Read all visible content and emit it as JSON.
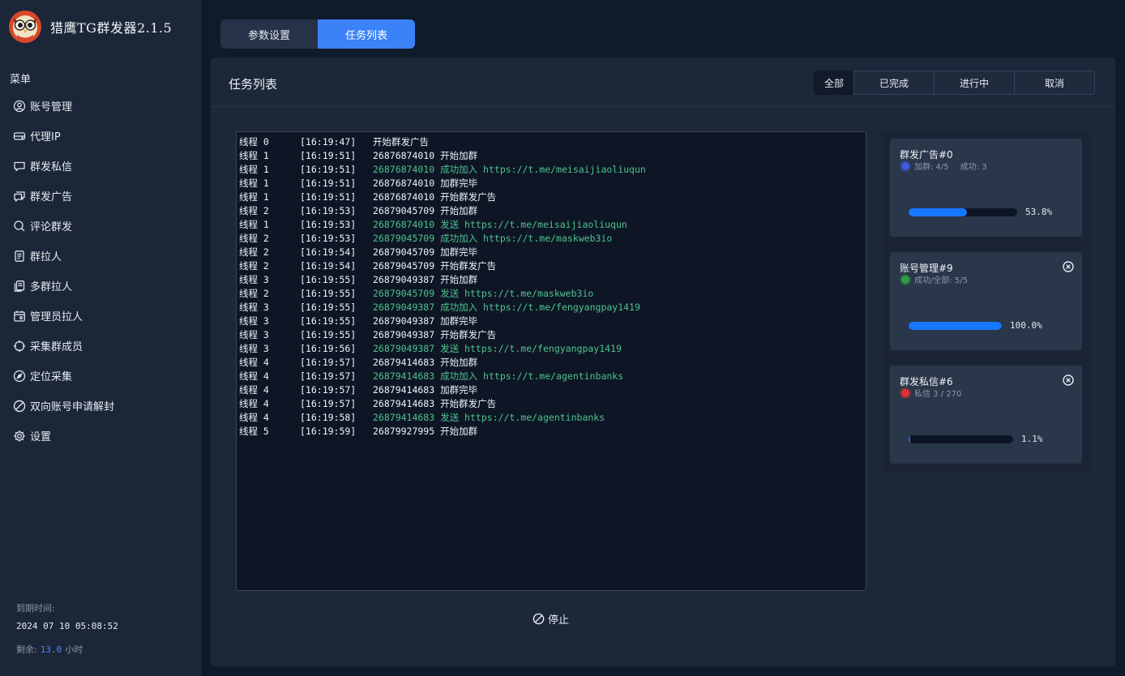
{
  "app": {
    "title": "猎鹰TG群发器2.1.5"
  },
  "sidebar": {
    "menu_label": "菜单",
    "items": [
      {
        "label": "账号管理",
        "icon": "user-circle-icon"
      },
      {
        "label": "代理IP",
        "icon": "server-icon"
      },
      {
        "label": "群发私信",
        "icon": "chat-bubble-icon"
      },
      {
        "label": "群发广告",
        "icon": "chat-bubbles-icon"
      },
      {
        "label": "评论群发",
        "icon": "comment-search-icon"
      },
      {
        "label": "群拉人",
        "icon": "document-icon"
      },
      {
        "label": "多群拉人",
        "icon": "documents-icon"
      },
      {
        "label": "管理员拉人",
        "icon": "calendar-user-icon"
      },
      {
        "label": "采集群成员",
        "icon": "crosshair-icon"
      },
      {
        "label": "定位采集",
        "icon": "compass-icon"
      },
      {
        "label": "双向账号申请解封",
        "icon": "ban-icon"
      },
      {
        "label": "设置",
        "icon": "gear-icon"
      }
    ],
    "expiry_label": "到期时间:",
    "expiry_value": "2024 07 10 05:08:52",
    "remaining_label": "剩余:",
    "remaining_value": "13.0",
    "remaining_unit": "小时"
  },
  "top_tabs": [
    "参数设置",
    "任务列表"
  ],
  "panel": {
    "title": "任务列表",
    "filters": [
      "全部",
      "已完成",
      "进行中",
      "取消"
    ]
  },
  "log": [
    {
      "thread": "线程 0",
      "time": "[16:19:47]",
      "account": "",
      "action": "开始群发广告",
      "url": "",
      "success": false
    },
    {
      "thread": "线程 1",
      "time": "[16:19:51]",
      "account": "26876874010",
      "action": "开始加群",
      "url": "",
      "success": false
    },
    {
      "thread": "线程 1",
      "time": "[16:19:51]",
      "account": "26876874010",
      "action": "成功加入",
      "url": "https://t.me/meisaijiaoliuqun",
      "success": true
    },
    {
      "thread": "线程 1",
      "time": "[16:19:51]",
      "account": "26876874010",
      "action": "加群完毕",
      "url": "",
      "success": false
    },
    {
      "thread": "线程 1",
      "time": "[16:19:51]",
      "account": "26876874010",
      "action": "开始群发广告",
      "url": "",
      "success": false
    },
    {
      "thread": "线程 2",
      "time": "[16:19:53]",
      "account": "26879045709",
      "action": "开始加群",
      "url": "",
      "success": false
    },
    {
      "thread": "线程 1",
      "time": "[16:19:53]",
      "account": "26876874010",
      "action": "发送",
      "url": "https://t.me/meisaijiaoliuqun",
      "success": true
    },
    {
      "thread": "线程 2",
      "time": "[16:19:53]",
      "account": "26879045709",
      "action": "成功加入",
      "url": "https://t.me/maskweb3io",
      "success": true
    },
    {
      "thread": "线程 2",
      "time": "[16:19:54]",
      "account": "26879045709",
      "action": "加群完毕",
      "url": "",
      "success": false
    },
    {
      "thread": "线程 2",
      "time": "[16:19:54]",
      "account": "26879045709",
      "action": "开始群发广告",
      "url": "",
      "success": false
    },
    {
      "thread": "线程 3",
      "time": "[16:19:55]",
      "account": "26879049387",
      "action": "开始加群",
      "url": "",
      "success": false
    },
    {
      "thread": "线程 2",
      "time": "[16:19:55]",
      "account": "26879045709",
      "action": "发送",
      "url": "https://t.me/maskweb3io",
      "success": true
    },
    {
      "thread": "线程 3",
      "time": "[16:19:55]",
      "account": "26879049387",
      "action": "成功加入",
      "url": "https://t.me/fengyangpay1419",
      "success": true
    },
    {
      "thread": "线程 3",
      "time": "[16:19:55]",
      "account": "26879049387",
      "action": "加群完毕",
      "url": "",
      "success": false
    },
    {
      "thread": "线程 3",
      "time": "[16:19:55]",
      "account": "26879049387",
      "action": "开始群发广告",
      "url": "",
      "success": false
    },
    {
      "thread": "线程 3",
      "time": "[16:19:56]",
      "account": "26879049387",
      "action": "发送",
      "url": "https://t.me/fengyangpay1419",
      "success": true
    },
    {
      "thread": "线程 4",
      "time": "[16:19:57]",
      "account": "26879414683",
      "action": "开始加群",
      "url": "",
      "success": false
    },
    {
      "thread": "线程 4",
      "time": "[16:19:57]",
      "account": "26879414683",
      "action": "成功加入",
      "url": "https://t.me/agentinbanks",
      "success": true
    },
    {
      "thread": "线程 4",
      "time": "[16:19:57]",
      "account": "26879414683",
      "action": "加群完毕",
      "url": "",
      "success": false
    },
    {
      "thread": "线程 4",
      "time": "[16:19:57]",
      "account": "26879414683",
      "action": "开始群发广告",
      "url": "",
      "success": false
    },
    {
      "thread": "线程 4",
      "time": "[16:19:58]",
      "account": "26879414683",
      "action": "发送",
      "url": "https://t.me/agentinbanks",
      "success": true
    },
    {
      "thread": "线程 5",
      "time": "[16:19:59]",
      "account": "26879927995",
      "action": "开始加群",
      "url": "",
      "success": false
    }
  ],
  "stop_label": "停止",
  "tasks": [
    {
      "title": "群发广告#0",
      "detail1": "加群: 4/5",
      "detail2": "成功: 3",
      "percent_label": "53.8%",
      "progress": 0.538,
      "dot_color": "#3b5bdb",
      "closable": false
    },
    {
      "title": "账号管理#9",
      "detail1": "成功/全部: 5/5",
      "detail2": "",
      "percent_label": "100.0%",
      "progress": 1.0,
      "dot_color": "#2f9e44",
      "closable": true
    },
    {
      "title": "群发私信#6",
      "detail1": "私信 3 / 270",
      "detail2": "",
      "percent_label": "1.1%",
      "progress": 0.011,
      "dot_color": "#e03131",
      "closable": true
    }
  ],
  "colors": {
    "accent": "#3b82f6",
    "progress": "#1677ff",
    "success_text": "#4fc28d"
  }
}
